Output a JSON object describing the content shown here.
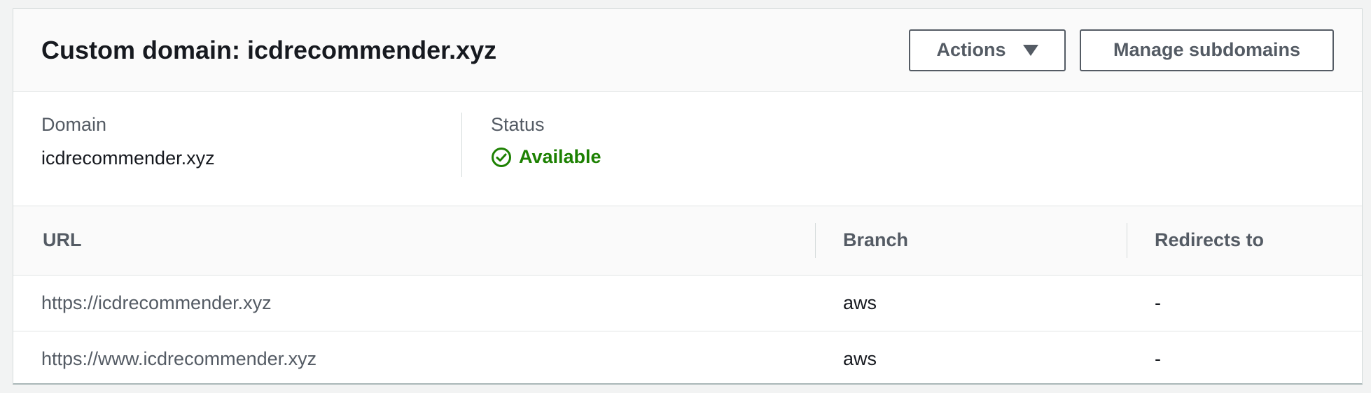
{
  "header": {
    "title": "Custom domain: icdrecommender.xyz",
    "actions_label": "Actions",
    "manage_label": "Manage subdomains"
  },
  "summary": {
    "domain_label": "Domain",
    "domain_value": "icdrecommender.xyz",
    "status_label": "Status",
    "status_value": "Available",
    "status_color": "#1d8102"
  },
  "table": {
    "columns": [
      "URL",
      "Branch",
      "Redirects to"
    ],
    "rows": [
      {
        "url": "https://icdrecommender.xyz",
        "branch": "aws",
        "redirects_to": "-"
      },
      {
        "url": "https://www.icdrecommender.xyz",
        "branch": "aws",
        "redirects_to": "-"
      }
    ]
  }
}
